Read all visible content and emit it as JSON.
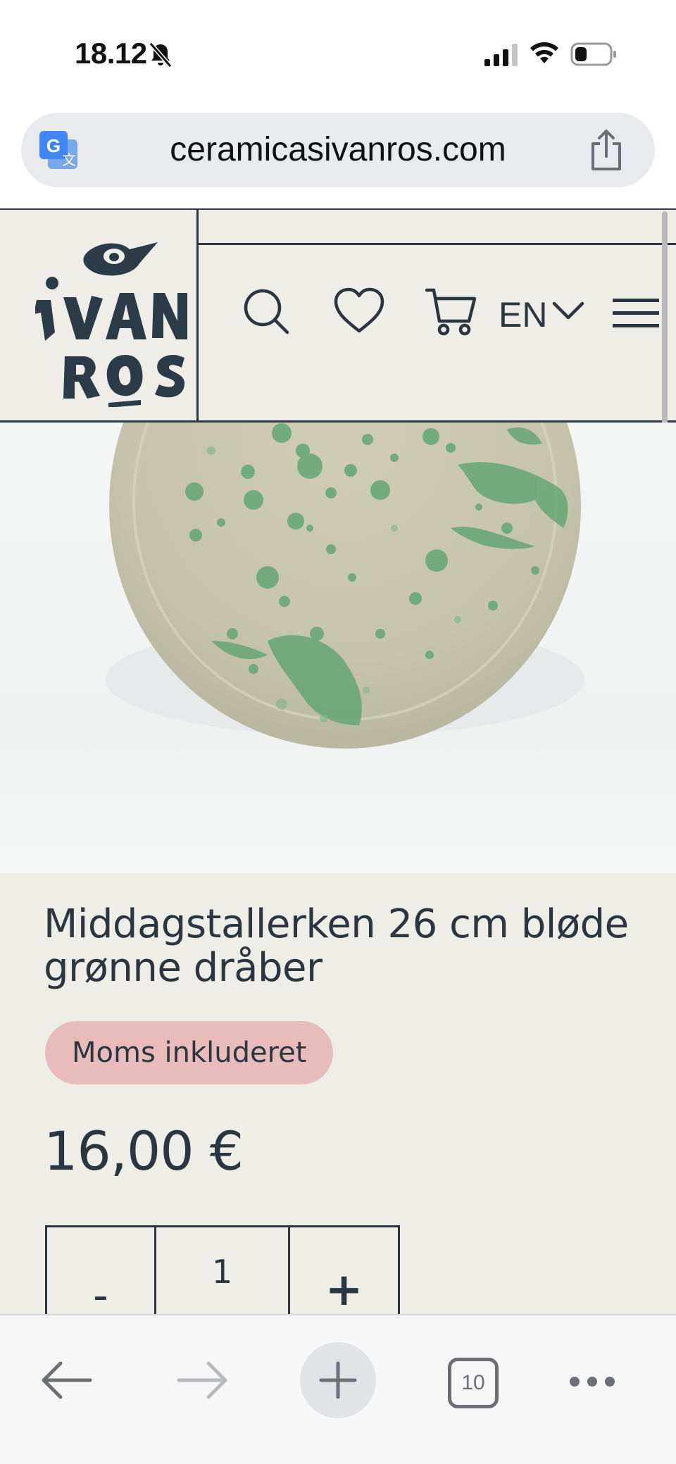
{
  "status_bar": {
    "time": "18.12"
  },
  "browser": {
    "url": "ceramicasivanros.com",
    "tab_count": "10"
  },
  "site_header": {
    "logo_text": "IVAN ROS",
    "language": "EN"
  },
  "product": {
    "title": "Middagstallerken 26 cm bløde grønne dråber",
    "vat_badge": "Moms inkluderet",
    "price": "16,00 €",
    "quantity": {
      "minus_label": "-",
      "value": "1",
      "plus_label": "+"
    }
  },
  "colors": {
    "ink": "#2b3640",
    "page_bg": "#efede8",
    "badge_bg": "#e8bcbb",
    "plate_glaze": "#c8c6ac",
    "splash_green": "#6aa878"
  },
  "icons": [
    "bell-slash-icon",
    "signal-icon",
    "wifi-icon",
    "battery-icon",
    "translate-icon",
    "share-icon",
    "search-icon",
    "heart-icon",
    "cart-icon",
    "chevron-down-icon",
    "menu-icon",
    "back-arrow-icon",
    "forward-arrow-icon",
    "plus-icon",
    "tabs-icon",
    "more-icon"
  ]
}
